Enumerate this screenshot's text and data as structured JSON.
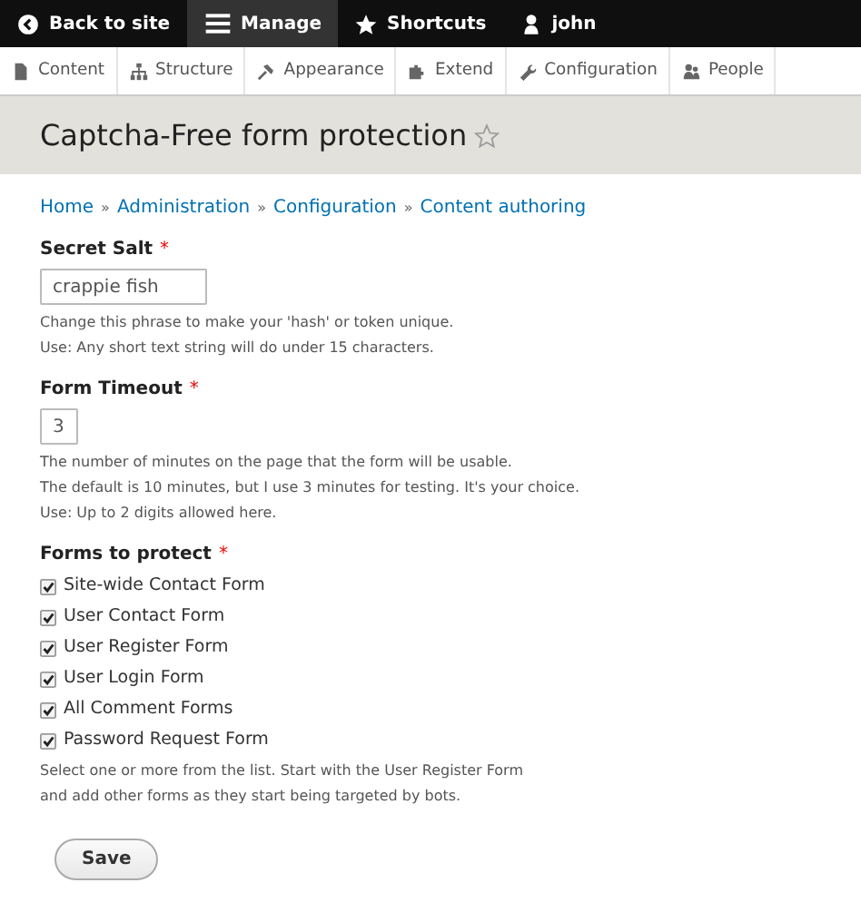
{
  "toolbar": [
    {
      "label": "Back to site",
      "selected": false
    },
    {
      "label": "Manage",
      "selected": true
    },
    {
      "label": "Shortcuts",
      "selected": false
    },
    {
      "label": "john",
      "selected": false
    }
  ],
  "tray": [
    {
      "label": "Content"
    },
    {
      "label": "Structure"
    },
    {
      "label": "Appearance"
    },
    {
      "label": "Extend"
    },
    {
      "label": "Configuration"
    },
    {
      "label": "People"
    }
  ],
  "page_title": "Captcha-Free form protection",
  "breadcrumb": [
    "Home",
    "Administration",
    "Configuration",
    "Content authoring"
  ],
  "breadcrumb_separator": "»",
  "fields": [
    {
      "kind": "text",
      "label": "Secret Salt",
      "required_mark": "*",
      "value": "crappie fish",
      "description": [
        "Change this phrase to make your 'hash' or token unique.",
        "Use: Any short text string will do under 15 characters."
      ]
    },
    {
      "kind": "number",
      "label": "Form Timeout",
      "required_mark": "*",
      "value": "3",
      "description": [
        "The number of minutes on the page that the form will be usable.",
        "The default is 10 minutes, but I use 3 minutes for testing. It's your choice.",
        "Use: Up to 2 digits allowed here."
      ]
    },
    {
      "kind": "checkboxes",
      "label": "Forms to protect",
      "required_mark": "*",
      "options": [
        {
          "label": "Site-wide Contact Form",
          "checked": true
        },
        {
          "label": "User Contact Form",
          "checked": true
        },
        {
          "label": "User Register Form",
          "checked": true
        },
        {
          "label": "User Login Form",
          "checked": true
        },
        {
          "label": "All Comment Forms",
          "checked": true
        },
        {
          "label": "Password Request Form",
          "checked": true
        }
      ],
      "description": [
        "Select one or more from the list. Start with the User Register Form",
        "and add other forms as they start being targeted by bots."
      ]
    }
  ],
  "save_button": "Save"
}
